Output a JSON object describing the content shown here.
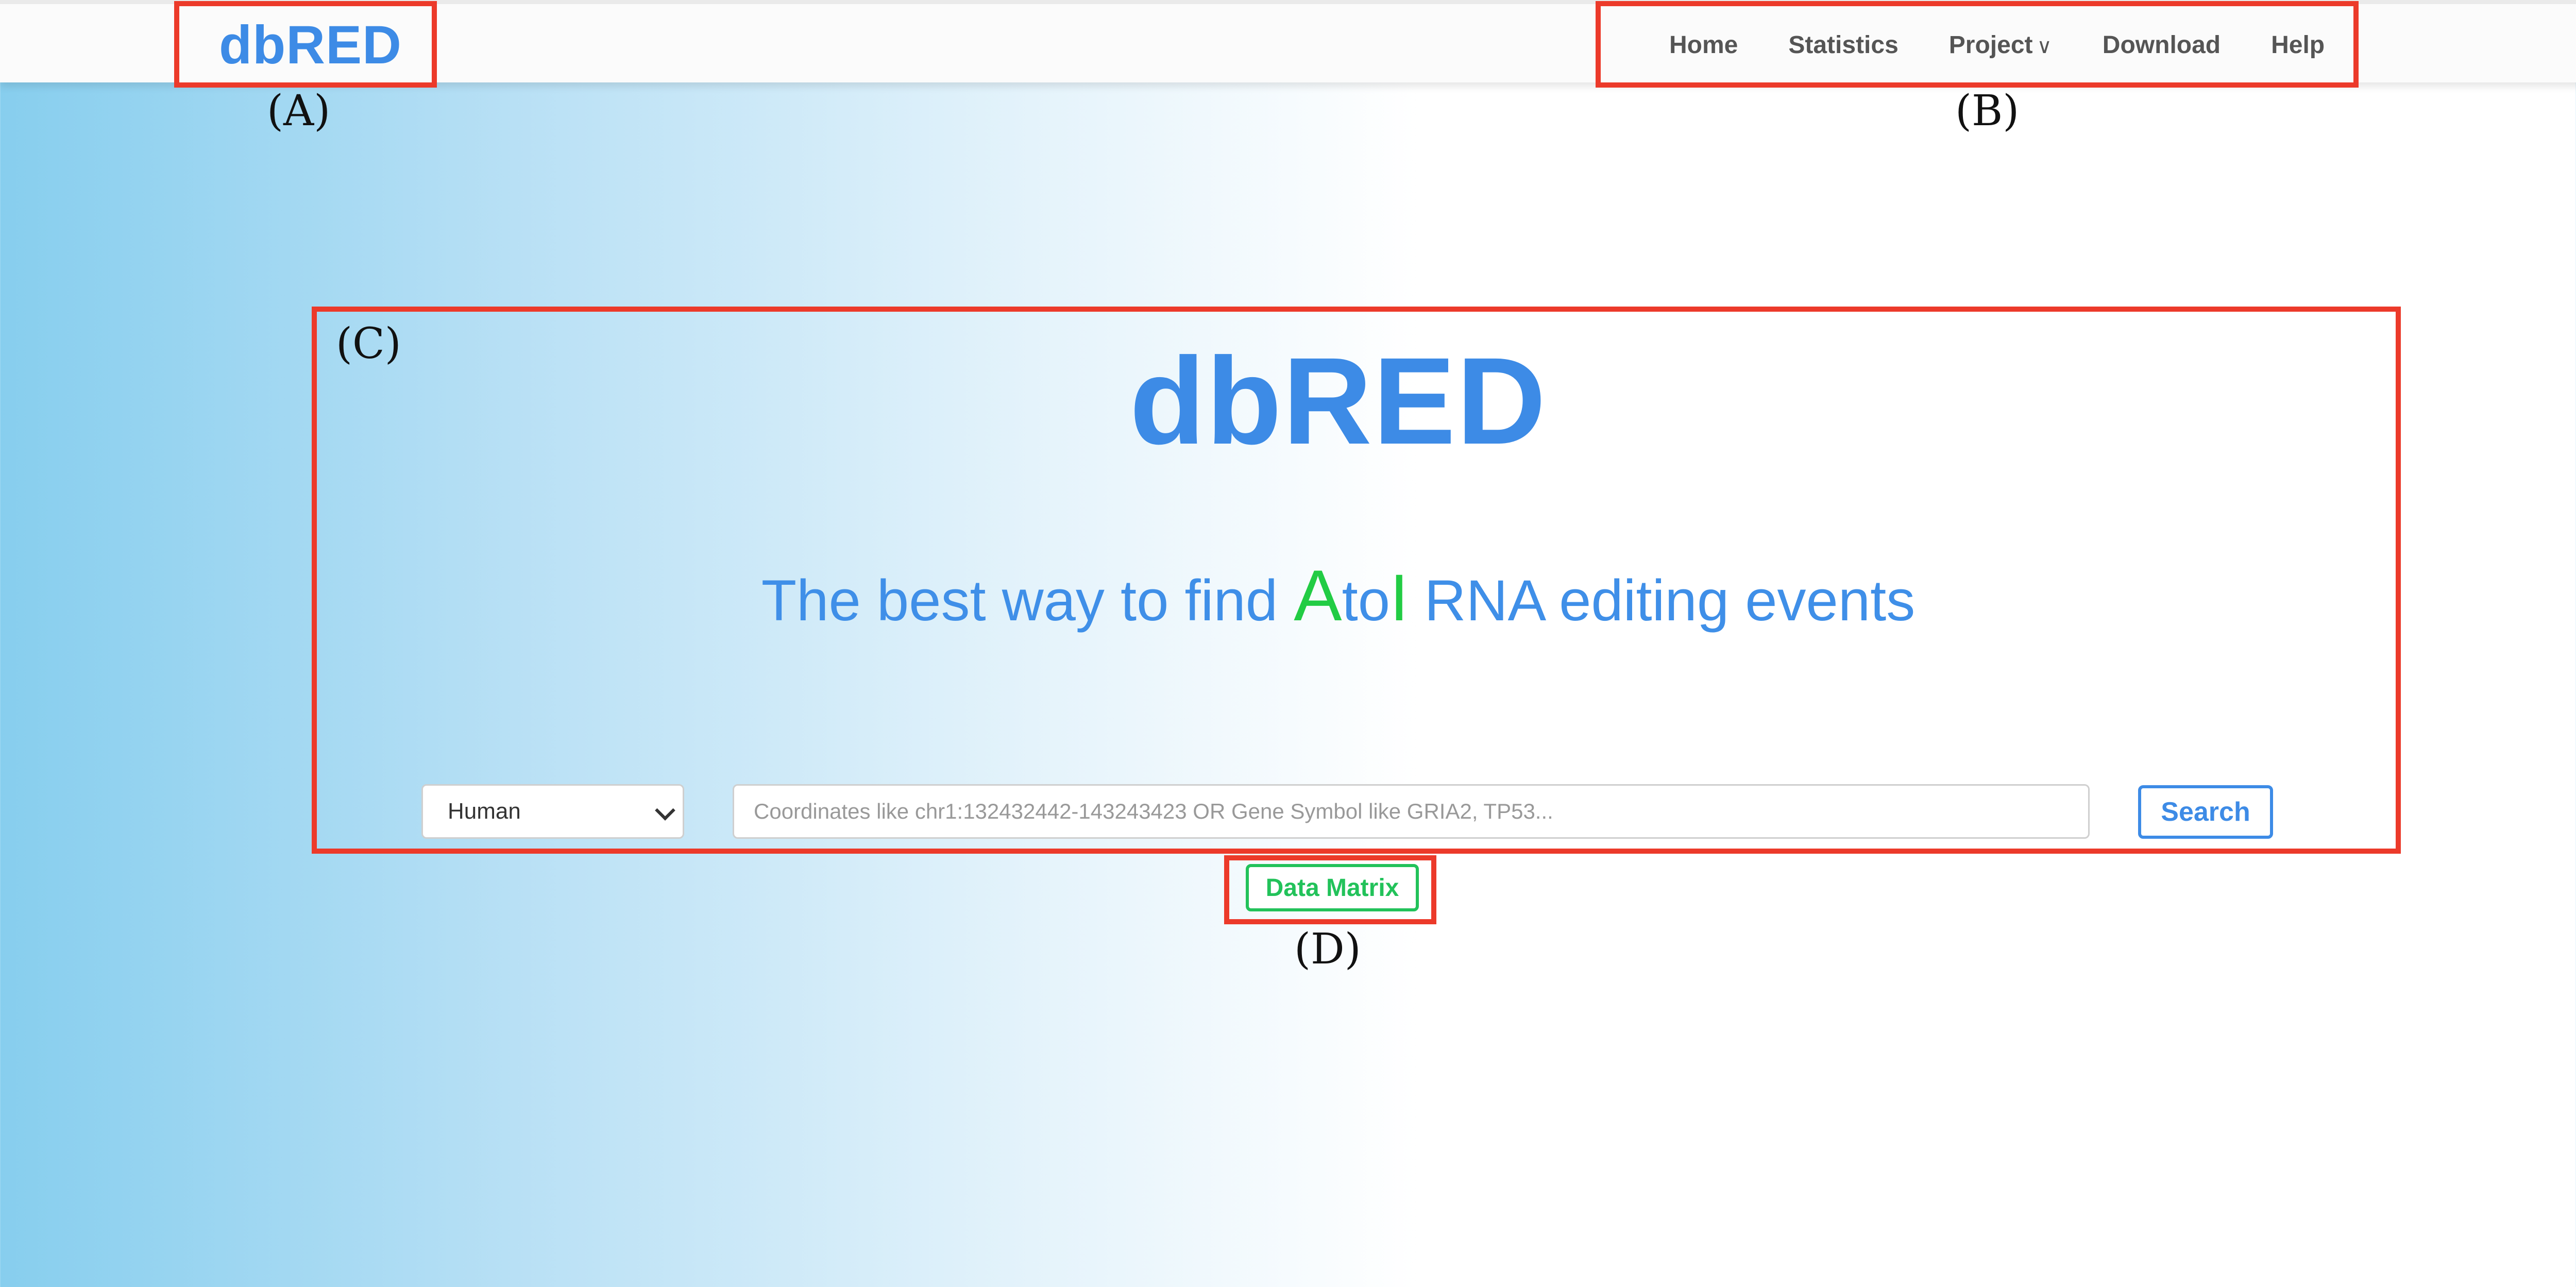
{
  "navbar": {
    "brand": "dbRED",
    "items": [
      {
        "label": "Home"
      },
      {
        "label": "Statistics"
      },
      {
        "label": "Project",
        "caret": "∨"
      },
      {
        "label": "Download"
      },
      {
        "label": "Help"
      }
    ]
  },
  "hero": {
    "title": "dbRED",
    "tagline": {
      "prefix": "The best way to find ",
      "letter_a": "A",
      "middle": "to",
      "letter_i": "I",
      "suffix": " RNA editing events"
    }
  },
  "search": {
    "species_selected": "Human",
    "placeholder": "Coordinates like chr1:132432442-143243423 OR Gene Symbol like GRIA2, TP53...",
    "button_label": "Search"
  },
  "data_matrix": {
    "label": "Data Matrix"
  },
  "annotations": {
    "a": "(A)",
    "b": "(B)",
    "c": "(C)",
    "d": "(D)"
  },
  "colors": {
    "brand_blue": "#3d8be6",
    "accent_green": "#22c25a",
    "annotation_red": "#ec3a2a"
  }
}
